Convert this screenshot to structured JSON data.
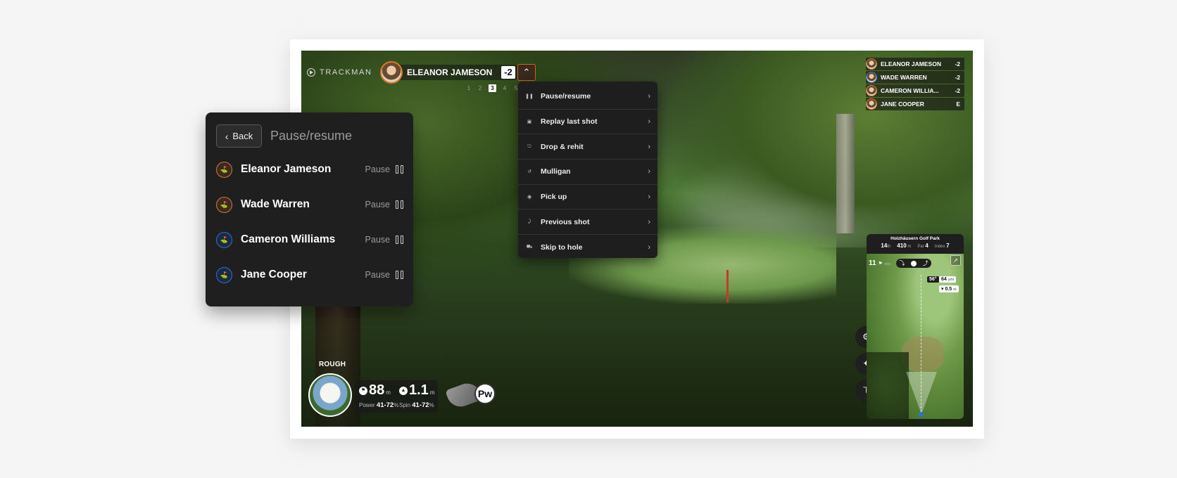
{
  "topbar": {
    "brand": "TRACKMAN",
    "player_name": "ELEANOR JAMESON",
    "player_score": "-2",
    "holes": [
      "1",
      "2",
      "3",
      "4",
      "5"
    ],
    "current_hole": "3"
  },
  "menu": {
    "items": [
      {
        "label": "Pause/resume",
        "icon": "pause-icon"
      },
      {
        "label": "Replay last shot",
        "icon": "replay-icon"
      },
      {
        "label": "Drop & rehit",
        "icon": "drop-icon"
      },
      {
        "label": "Mulligan",
        "icon": "undo-icon"
      },
      {
        "label": "Pick up",
        "icon": "pick-up-icon"
      },
      {
        "label": "Previous shot",
        "icon": "previous-shot-icon"
      },
      {
        "label": "Skip to hole",
        "icon": "skip-icon"
      }
    ]
  },
  "leaderboard": [
    {
      "name": "ELEANOR JAMESON",
      "score": "-2",
      "team": "orange"
    },
    {
      "name": "WADE WARREN",
      "score": "-2",
      "team": "blue"
    },
    {
      "name": "CAMERON WILLIA...",
      "score": "-2",
      "team": "orange"
    },
    {
      "name": "JANE COOPER",
      "score": "E",
      "team": "orange"
    }
  ],
  "panel": {
    "back_label": "Back",
    "title": "Pause/resume",
    "players": [
      {
        "name": "Eleanor Jameson",
        "action": "Pause",
        "team": "orange"
      },
      {
        "name": "Wade Warren",
        "action": "Pause",
        "team": "orange"
      },
      {
        "name": "Cameron Williams",
        "action": "Pause",
        "team": "blue"
      },
      {
        "name": "Jane Cooper",
        "action": "Pause",
        "team": "blue"
      }
    ]
  },
  "hud": {
    "lie": "ROUGH",
    "carry_value": "88",
    "carry_unit": "m",
    "spin_value": "1.1",
    "spin_unit": "m",
    "power_label": "Power",
    "power_range": "41-72",
    "power_unit": "%",
    "spin_label": "Spin",
    "spin_range": "41-72",
    "spin_range_unit": "%",
    "club": "Pw"
  },
  "minimap": {
    "course": "Holzhäusern Golf Park",
    "hole_number": "14",
    "hole_suffix": "th",
    "distance": "410",
    "distance_unit": "m",
    "par_label": "Par",
    "par": "4",
    "index_label": "Index",
    "index": "7",
    "wind": "11",
    "wind_unit": "m/s",
    "angle": "56°",
    "yards": "64",
    "yards_unit": "yds",
    "elevation": "▾ 0.5",
    "elevation_unit": "m"
  },
  "colors": {
    "accent_orange": "#d9782c",
    "accent_blue": "#2a72d6",
    "panel_bg": "#1f1f1f"
  }
}
